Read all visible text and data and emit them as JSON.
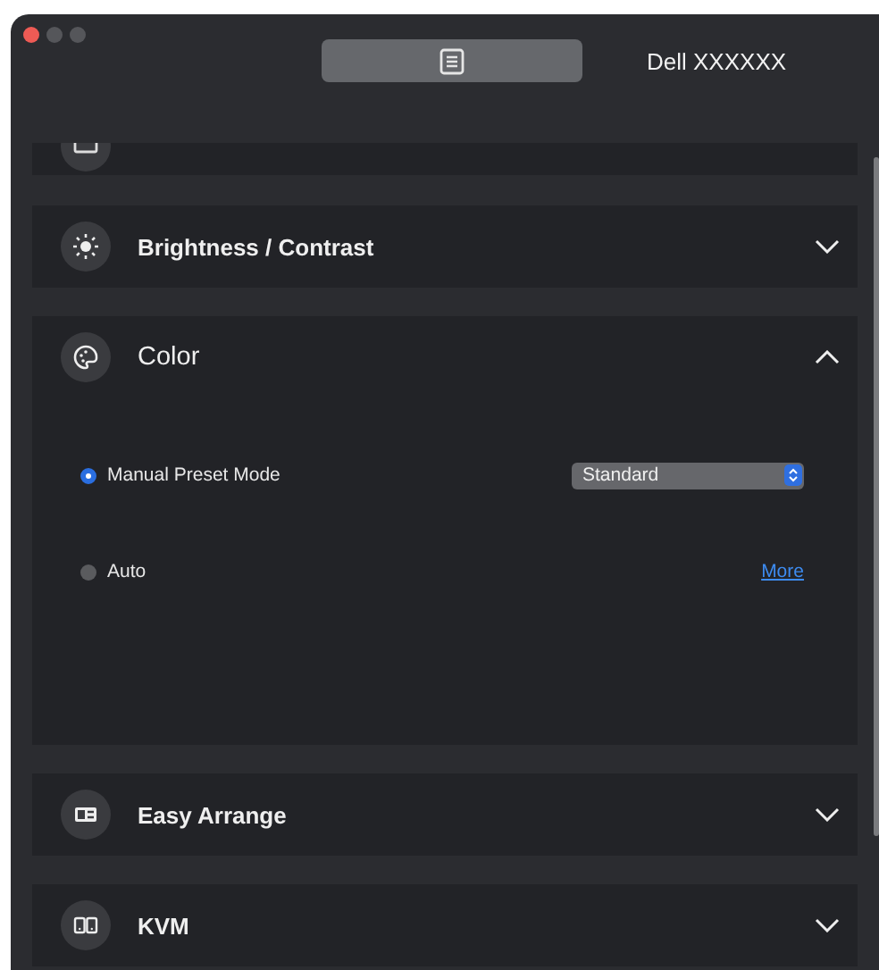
{
  "window": {
    "title": "Dell XXXXXX"
  },
  "sections": [
    {
      "kind": "cut"
    },
    {
      "kind": "panel",
      "label": "Brightness / Contrast",
      "expanded": false
    },
    {
      "kind": "panel",
      "label": "Color",
      "expanded": true,
      "options": [
        {
          "label": "Manual Preset Mode",
          "selected": true,
          "control": {
            "kind": "select",
            "value": "Standard"
          }
        },
        {
          "label": "Auto",
          "selected": false,
          "control": {
            "kind": "link",
            "label": "More"
          }
        }
      ]
    },
    {
      "kind": "panel",
      "label": "Easy Arrange",
      "expanded": false
    },
    {
      "kind": "panel",
      "label": "KVM",
      "expanded": false
    }
  ]
}
